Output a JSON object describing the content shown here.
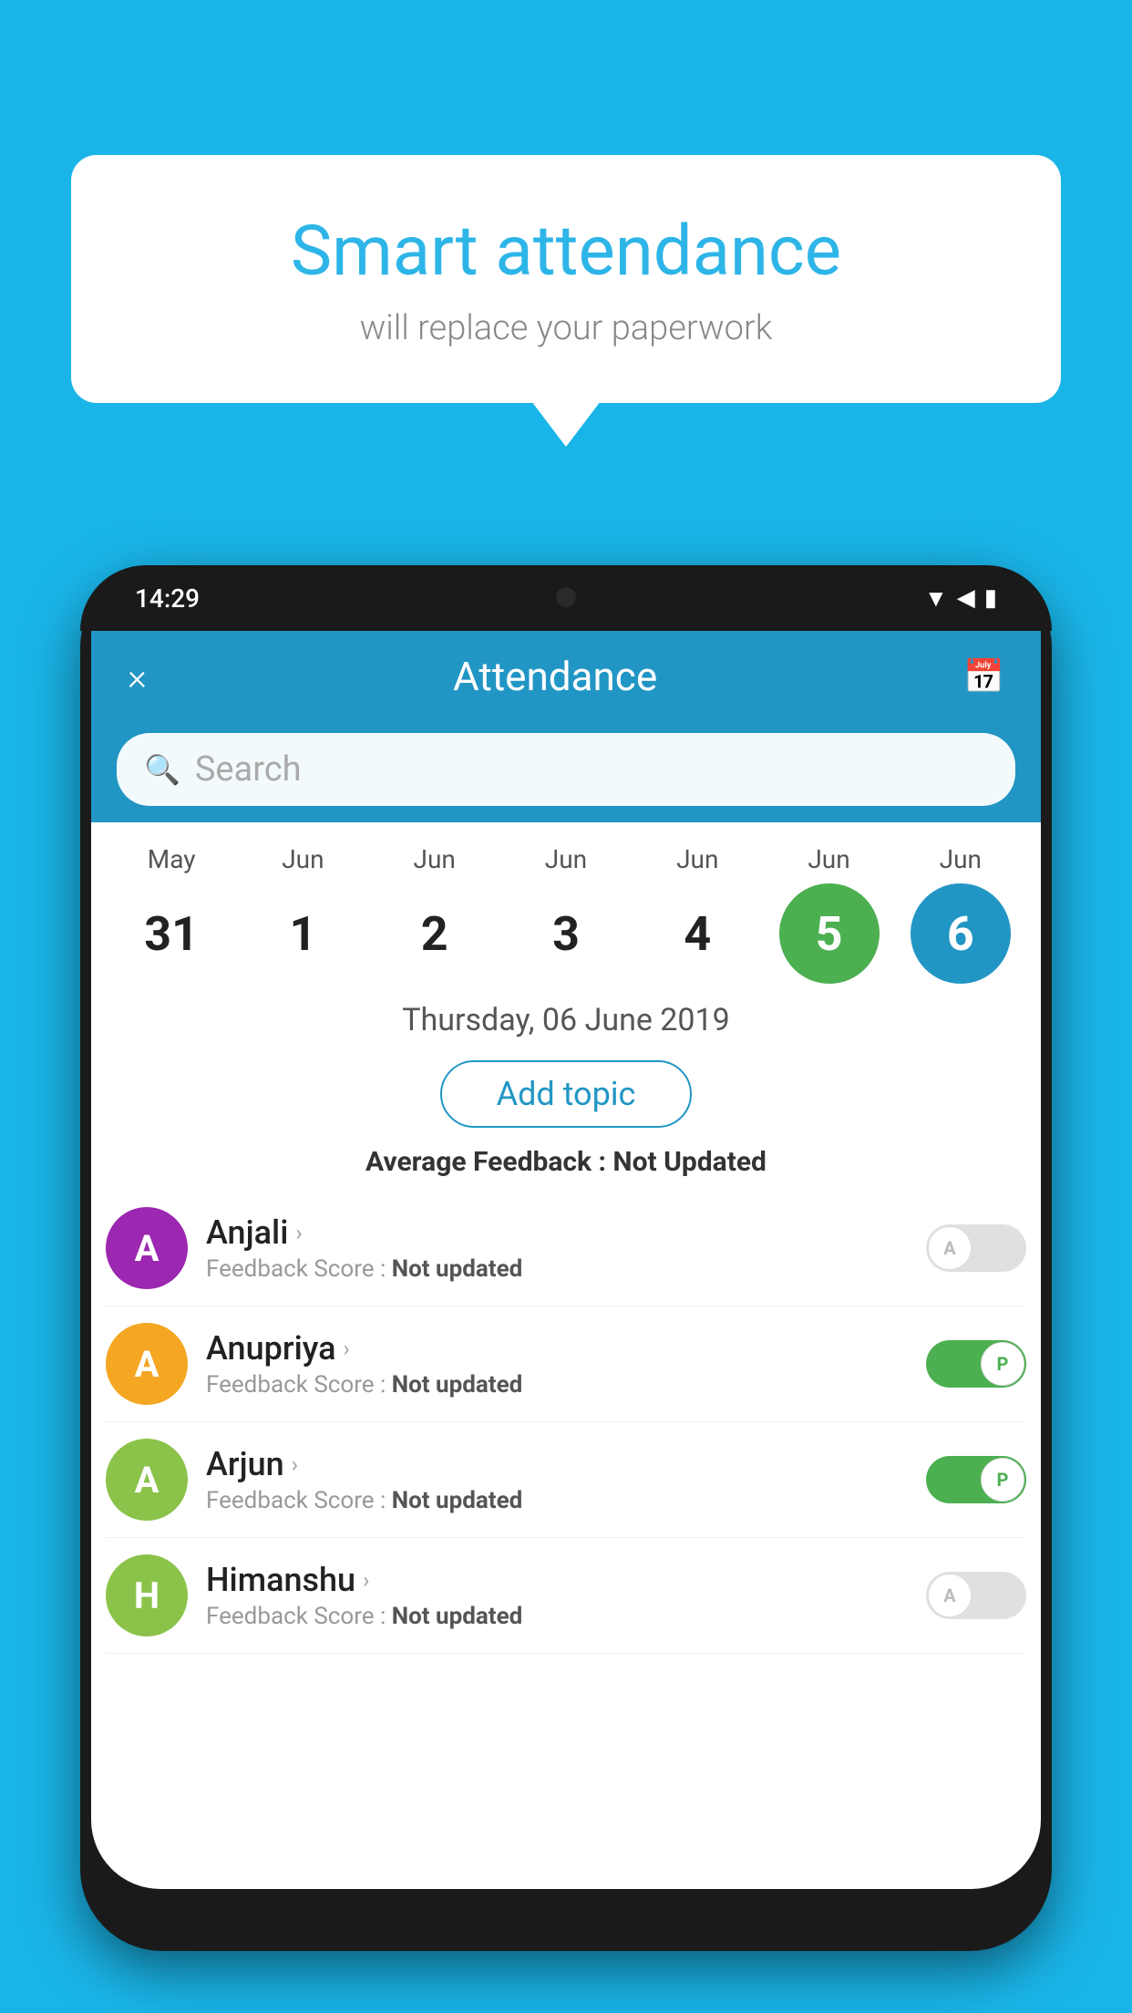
{
  "background": {
    "color": "#1ab5e8"
  },
  "bubble": {
    "title": "Smart attendance",
    "subtitle": "will replace your paperwork"
  },
  "phone": {
    "statusBar": {
      "time": "14:29",
      "icons": [
        "wifi",
        "signal",
        "battery"
      ]
    },
    "header": {
      "title": "Attendance",
      "closeLabel": "×",
      "calendarIcon": "📅"
    },
    "search": {
      "placeholder": "Search"
    },
    "calendar": {
      "days": [
        {
          "month": "May",
          "num": "31",
          "state": "normal"
        },
        {
          "month": "Jun",
          "num": "1",
          "state": "normal"
        },
        {
          "month": "Jun",
          "num": "2",
          "state": "normal"
        },
        {
          "month": "Jun",
          "num": "3",
          "state": "normal"
        },
        {
          "month": "Jun",
          "num": "4",
          "state": "normal"
        },
        {
          "month": "Jun",
          "num": "5",
          "state": "today"
        },
        {
          "month": "Jun",
          "num": "6",
          "state": "selected"
        }
      ]
    },
    "dateLabel": "Thursday, 06 June 2019",
    "addTopicBtn": "Add topic",
    "avgFeedback": {
      "label": "Average Feedback : ",
      "value": "Not Updated"
    },
    "students": [
      {
        "name": "Anjali",
        "avatarColor": "#9c27b0",
        "avatarLetter": "A",
        "feedback": "Not updated",
        "attendance": "absent",
        "toggleLabel": "A"
      },
      {
        "name": "Anupriya",
        "avatarColor": "#f5a623",
        "avatarLetter": "A",
        "feedback": "Not updated",
        "attendance": "present",
        "toggleLabel": "P"
      },
      {
        "name": "Arjun",
        "avatarColor": "#8bc34a",
        "avatarLetter": "A",
        "feedback": "Not updated",
        "attendance": "present",
        "toggleLabel": "P"
      },
      {
        "name": "Himanshu",
        "avatarColor": "#8bc34a",
        "avatarLetter": "H",
        "feedback": "Not updated",
        "attendance": "absent",
        "toggleLabel": "A"
      }
    ]
  }
}
